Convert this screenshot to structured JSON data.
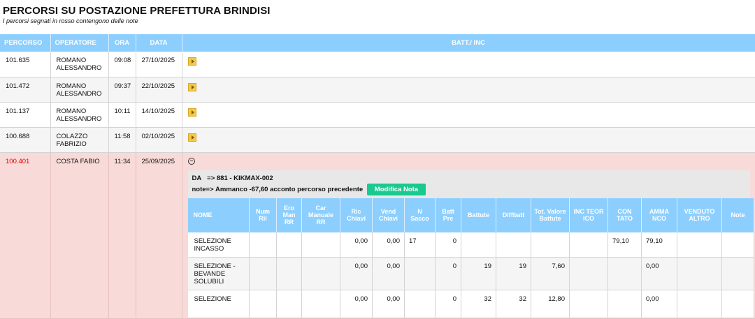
{
  "page": {
    "title": "PERCORSI SU POSTAZIONE PREFETTURA BRINDISI",
    "subtitle": "I percorsi segnati in rosso contengono delle note"
  },
  "columns": {
    "percorso": "PERCORSO",
    "operatore": "OPERATORE",
    "ora": "ORA",
    "data": "DATA",
    "batt_inc": "BATT./ INC"
  },
  "rows": [
    {
      "percorso": "101.635",
      "operatore": "ROMANO ALESSANDRO",
      "ora": "09:08",
      "data": "27/10/2025"
    },
    {
      "percorso": "101.472",
      "operatore": "ROMANO ALESSANDRO",
      "ora": "09:37",
      "data": "22/10/2025"
    },
    {
      "percorso": "101.137",
      "operatore": "ROMANO ALESSANDRO",
      "ora": "10:11",
      "data": "14/10/2025"
    },
    {
      "percorso": "100.688",
      "operatore": "COLAZZO FABRIZIO",
      "ora": "11:58",
      "data": "02/10/2025"
    }
  ],
  "expanded": {
    "percorso": "100.401",
    "operatore": "COSTA FABIO",
    "ora": "11:34",
    "data": "25/09/2025",
    "da_label": "DA",
    "da_value": "=> 881 - KIKMAX-002",
    "note_label": "note=>",
    "note_value": "Ammanco -67,60 acconto percorso precedente",
    "modifica_nota": "Modifica Nota",
    "headers": [
      "NOME",
      "Num Ril",
      "Ero Man RR",
      "Car Manuale RR",
      "Ric Chiavi",
      "Vend Chiavi",
      "N Sacco",
      "Batt Pre",
      "Battute",
      "Diffbatt",
      "Tot. Valore Battute",
      "INC TEOR ICO",
      "CON TATO",
      "AMMA NCO",
      "VENDUTO ALTRO",
      "Note"
    ],
    "items": [
      [
        "SELEZIONE INCASSO",
        "",
        "",
        "",
        "0,00",
        "0,00",
        "17",
        "0",
        "",
        "",
        "",
        "",
        "79,10",
        "79,10",
        "",
        ""
      ],
      [
        "SELEZIONE - BEVANDE SOLUBILI",
        "",
        "",
        "",
        "0,00",
        "0,00",
        "",
        "0",
        "19",
        "19",
        "7,60",
        "",
        "",
        "0,00",
        "",
        ""
      ],
      [
        "SELEZIONE",
        "",
        "",
        "",
        "0,00",
        "0,00",
        "",
        "0",
        "32",
        "32",
        "12,80",
        "",
        "",
        "0,00",
        "",
        ""
      ]
    ]
  }
}
